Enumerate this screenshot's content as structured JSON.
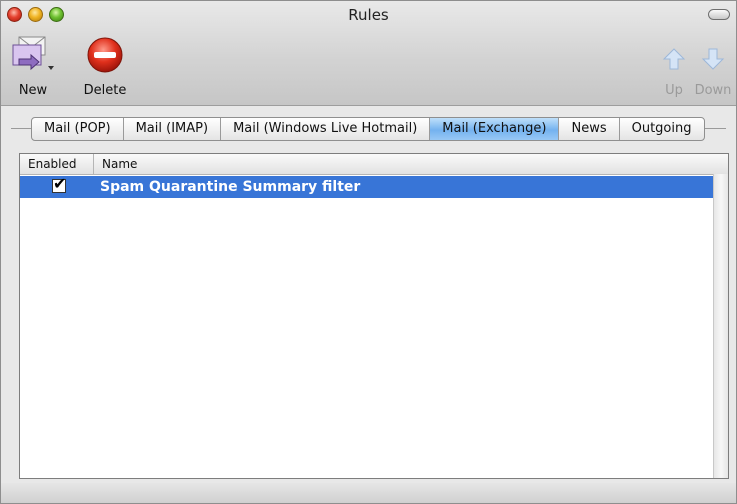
{
  "window": {
    "title": "Rules"
  },
  "toolbar": {
    "new_label": "New",
    "delete_label": "Delete",
    "up_label": "Up",
    "down_label": "Down"
  },
  "tabs": [
    {
      "label": "Mail (POP)",
      "active": false
    },
    {
      "label": "Mail (IMAP)",
      "active": false
    },
    {
      "label": "Mail (Windows Live Hotmail)",
      "active": false
    },
    {
      "label": "Mail (Exchange)",
      "active": true
    },
    {
      "label": "News",
      "active": false
    },
    {
      "label": "Outgoing",
      "active": false
    }
  ],
  "table": {
    "columns": [
      "Enabled",
      "Name"
    ],
    "rows": [
      {
        "enabled": true,
        "name": "Spam Quarantine Summary filter"
      }
    ]
  },
  "colors": {
    "selection": "#3875d7",
    "active_tab": "#74b2ef"
  }
}
